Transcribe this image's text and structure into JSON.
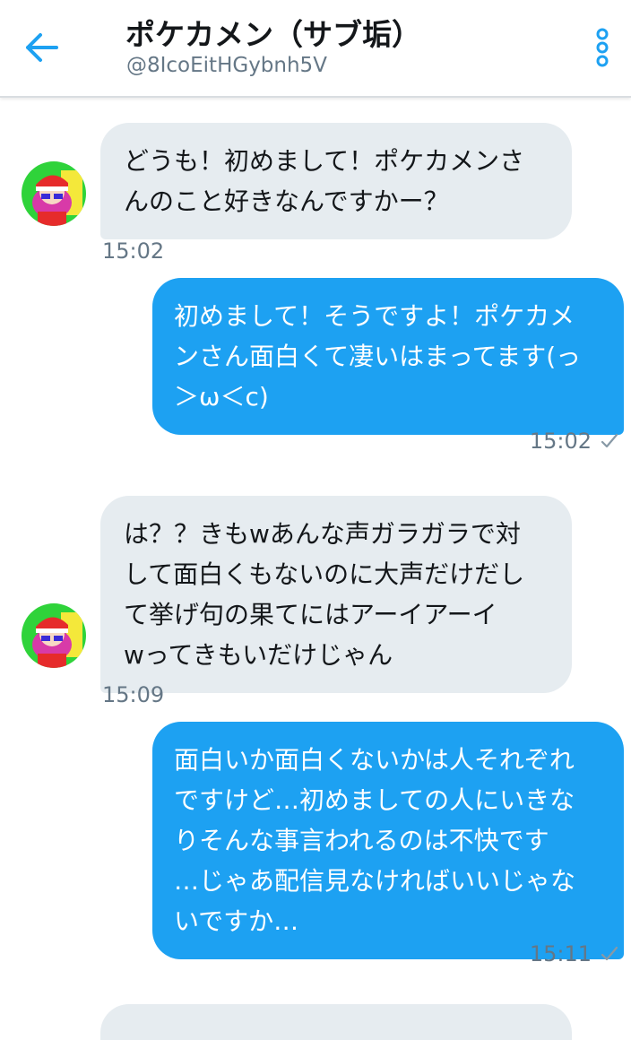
{
  "header": {
    "title": "ポケカメン（サブ垢）",
    "handle": "@8IcoEitHGybnh5V"
  },
  "messages": [
    {
      "direction": "incoming",
      "lines": [
        "どうも！初めまして！ポケカメンさ",
        "んのこと好きなんですかー？"
      ],
      "time": "15:02"
    },
    {
      "direction": "outgoing",
      "lines": [
        "初めまして！そうですよ！ポケカメ",
        "ンさん面白くて凄いはまってます(っ",
        "＞ω＜c)"
      ],
      "time": "15:02"
    },
    {
      "direction": "incoming",
      "lines": [
        "は？？きもwあんな声ガラガラで対",
        "して面白くもないのに大声だけだし",
        "て挙げ句の果てにはアーイアーイ",
        "wってきもいだけじゃん"
      ],
      "time": "15:09"
    },
    {
      "direction": "outgoing",
      "lines": [
        "面白いか面白くないかは人それぞれ",
        "ですけど…初めましての人にいきな",
        "りそんな事言われるのは不快です",
        "…じゃあ配信見なければいいじゃな",
        "いですか…"
      ],
      "time": "15:11"
    }
  ],
  "colors": {
    "accent": "#1da1f2",
    "incoming_bubble": "#e6ecf0",
    "meta_text": "#657786"
  },
  "icons": {
    "back": "arrow-left-icon",
    "more": "more-vertical-icon",
    "read": "checkmark-icon"
  }
}
